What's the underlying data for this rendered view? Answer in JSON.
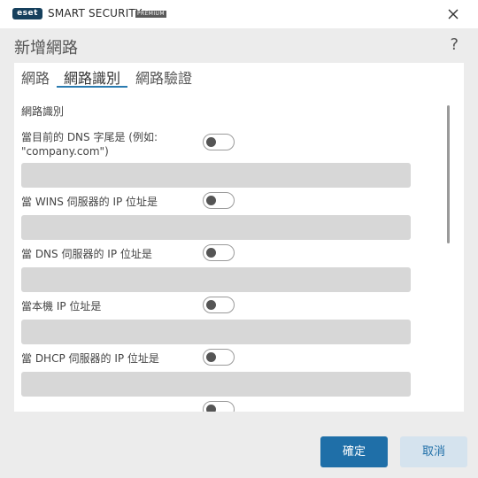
{
  "window": {
    "logo_text": "eset",
    "app_name": "SMART SECURITY",
    "edition": "PREMIUM"
  },
  "dialog": {
    "title": "新增網路",
    "help": "?"
  },
  "tabs": [
    {
      "label": "網路",
      "active": false
    },
    {
      "label": "網路識別",
      "active": true
    },
    {
      "label": "網路驗證",
      "active": false
    }
  ],
  "section_title": "網路識別",
  "rows": [
    {
      "label_line1": "當目前的 DNS 字尾是 (例如:",
      "label_line2": "\"company.com\")",
      "enabled": false,
      "value": ""
    },
    {
      "label_line1": "當 WINS 伺服器的 IP 位址是",
      "enabled": false,
      "value": ""
    },
    {
      "label_line1": "當 DNS 伺服器的 IP 位址是",
      "enabled": false,
      "value": ""
    },
    {
      "label_line1": "當本機 IP 位址是",
      "enabled": false,
      "value": ""
    },
    {
      "label_line1": "當 DHCP 伺服器的 IP 位址是",
      "enabled": false,
      "value": ""
    }
  ],
  "buttons": {
    "ok": "確定",
    "cancel": "取消"
  },
  "colors": {
    "accent": "#1f6fa8",
    "tab_underline": "#2a7bb0",
    "field_bg": "#d7d7d7",
    "window_bg": "#ececec"
  }
}
